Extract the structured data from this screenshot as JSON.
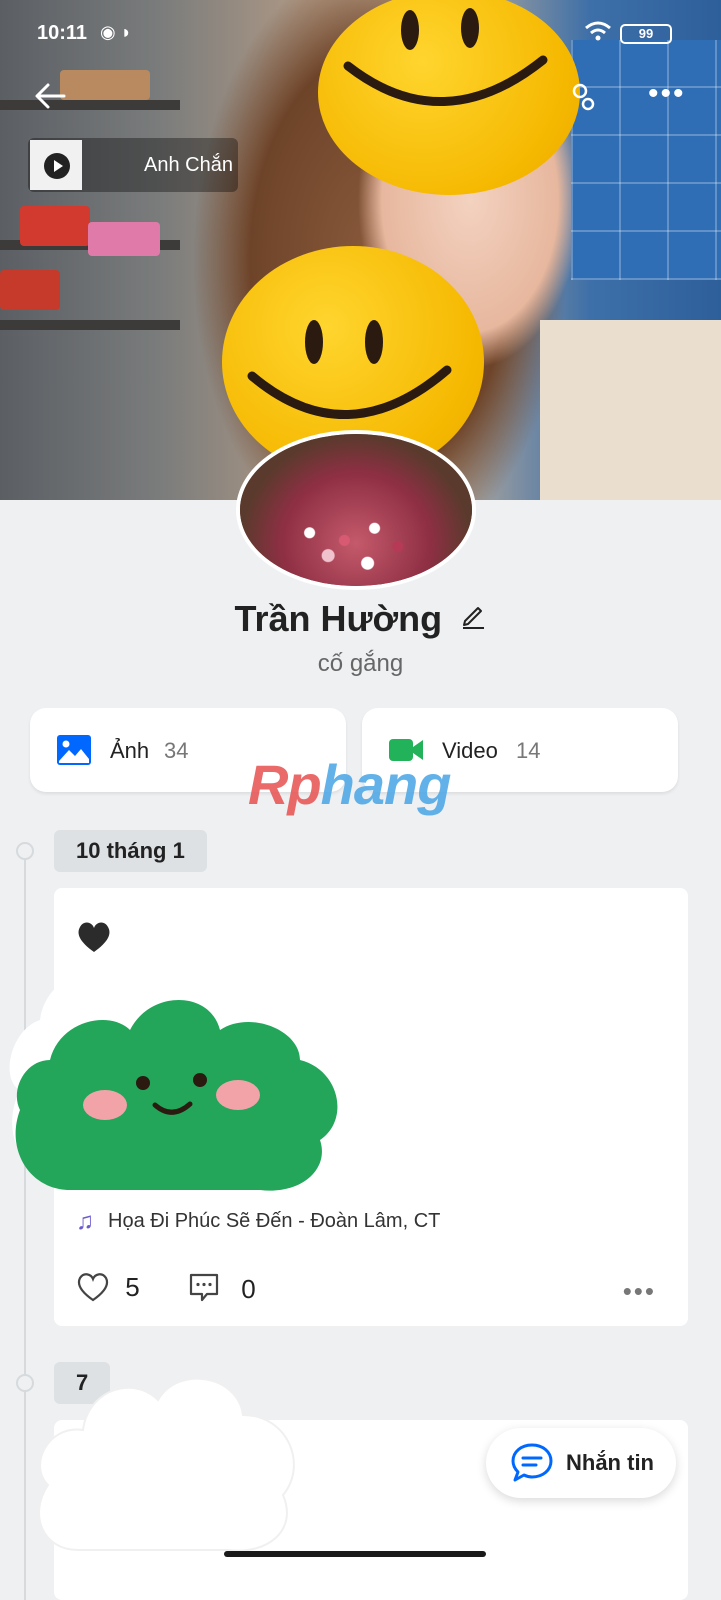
{
  "status_bar": {
    "time": "10:11",
    "battery": "99"
  },
  "cover": {
    "music_title": "Anh Chắn"
  },
  "profile": {
    "name": "Trần Hường",
    "bio": "cố gắng"
  },
  "media": {
    "photos": {
      "label": "Ảnh",
      "count": "34"
    },
    "videos": {
      "label": "Video",
      "count": "14"
    }
  },
  "watermark": {
    "part1": "Rp",
    "part2": "hang"
  },
  "timeline": {
    "posts": [
      {
        "date": "10 tháng 1",
        "music": "Họa Đi Phúc Sẽ Đến - Đoàn Lâm, CT",
        "likes": "5",
        "comments": "0"
      },
      {
        "date": "7"
      }
    ]
  },
  "message_button": {
    "label": "Nhắn tin"
  },
  "colors": {
    "accent": "#0068ff",
    "video_green": "#22b35a",
    "music_purple": "#6a5bd0",
    "background": "#eef0f2"
  },
  "icons": {
    "back": "arrow-left-icon",
    "settings": "user-settings-icon",
    "more": "more-horizontal-icon",
    "edit": "pencil-icon",
    "photo": "image-icon",
    "video": "video-camera-icon",
    "music": "music-note-icon",
    "like": "heart-outline-icon",
    "comment": "comment-icon",
    "message": "chat-bubble-icon"
  }
}
